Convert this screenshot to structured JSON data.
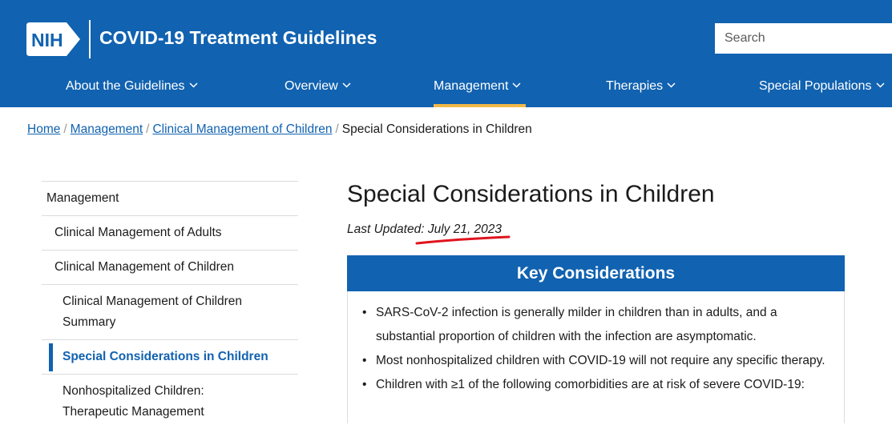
{
  "header": {
    "logo_text": "NIH",
    "site_title": "COVID-19 Treatment Guidelines",
    "search_placeholder": "Search"
  },
  "nav": [
    {
      "label": "About the Guidelines"
    },
    {
      "label": "Overview"
    },
    {
      "label": "Management",
      "active": true
    },
    {
      "label": "Therapies"
    },
    {
      "label": "Special Populations"
    }
  ],
  "breadcrumb": {
    "items": [
      "Home",
      "Management",
      "Clinical Management of Children"
    ],
    "current": "Special Considerations in Children"
  },
  "sidenav": [
    {
      "label": "Management",
      "level": 0
    },
    {
      "label": "Clinical Management of Adults",
      "level": 1
    },
    {
      "label": "Clinical Management of Children",
      "level": 1
    },
    {
      "label": "Clinical Management of Children Summary",
      "level": 2
    },
    {
      "label": "Special Considerations in Children",
      "level": 2,
      "current": true
    },
    {
      "label": "Nonhospitalized Children: Therapeutic Management",
      "level": 2
    }
  ],
  "main": {
    "title": "Special Considerations in Children",
    "last_updated_label": "Last Updated:",
    "last_updated_date": "July 21, 2023",
    "key_considerations": {
      "title": "Key Considerations",
      "items": [
        "SARS-CoV-2 infection is generally milder in children than in adults, and a substantial proportion of children with the infection are asymptomatic.",
        "Most nonhospitalized children with COVID-19 will not require any specific therapy.",
        "Children with ≥1 of the following comorbidities are at risk of severe COVID-19:"
      ]
    }
  },
  "colors": {
    "brand_blue": "#1162b0",
    "active_underline": "#f0b847",
    "annotation_red": "#e0141e"
  }
}
